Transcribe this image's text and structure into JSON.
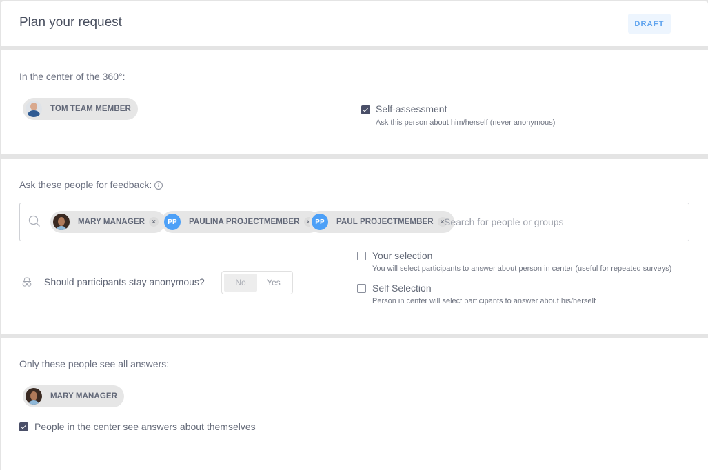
{
  "header": {
    "title": "Plan your request",
    "status": "DRAFT"
  },
  "center_section": {
    "label": "In the center of the 360°:",
    "person": {
      "name": "TOM TEAM MEMBER",
      "avatar": "photo"
    },
    "self_assessment": {
      "checked": true,
      "label": "Self-assessment",
      "description": "Ask this person about him/herself (never anonymous)"
    }
  },
  "feedback_section": {
    "label": "Ask these people for feedback:",
    "info_icon": "info-icon",
    "chips": [
      {
        "name": "MARY MANAGER",
        "avatar": "photo",
        "initials": ""
      },
      {
        "name": "PAULINA PROJECTMEMBER",
        "avatar": "initials",
        "initials": "PP"
      },
      {
        "name": "PAUL PROJECTMEMBER",
        "avatar": "initials",
        "initials": "PP"
      }
    ],
    "remove_glyph": "×",
    "search_placeholder": "Search for people or groups",
    "search_value": "",
    "anonymous": {
      "label": "Should participants stay anonymous?",
      "options": [
        "No",
        "Yes"
      ],
      "selected": "No"
    },
    "options": [
      {
        "checked": false,
        "label": "Your selection",
        "description": "You will select participants to answer about person in center (useful for repeated surveys)"
      },
      {
        "checked": false,
        "label": "Self Selection",
        "description": "Person in center will select participants to answer about his/herself"
      }
    ]
  },
  "visibility_section": {
    "label": "Only these people see all answers:",
    "person": {
      "name": "MARY MANAGER",
      "avatar": "photo"
    },
    "center_sees_answers": {
      "checked": true,
      "label": "People in the center see answers about themselves"
    }
  },
  "colors": {
    "badge_text": "#5ea3ee",
    "badge_bg": "#edf5fe",
    "checkbox_checked": "#4a4f68",
    "initials_avatar": "#4da0f7",
    "chip_bg": "#e6e6e6",
    "separator": "#e4e4e4"
  }
}
